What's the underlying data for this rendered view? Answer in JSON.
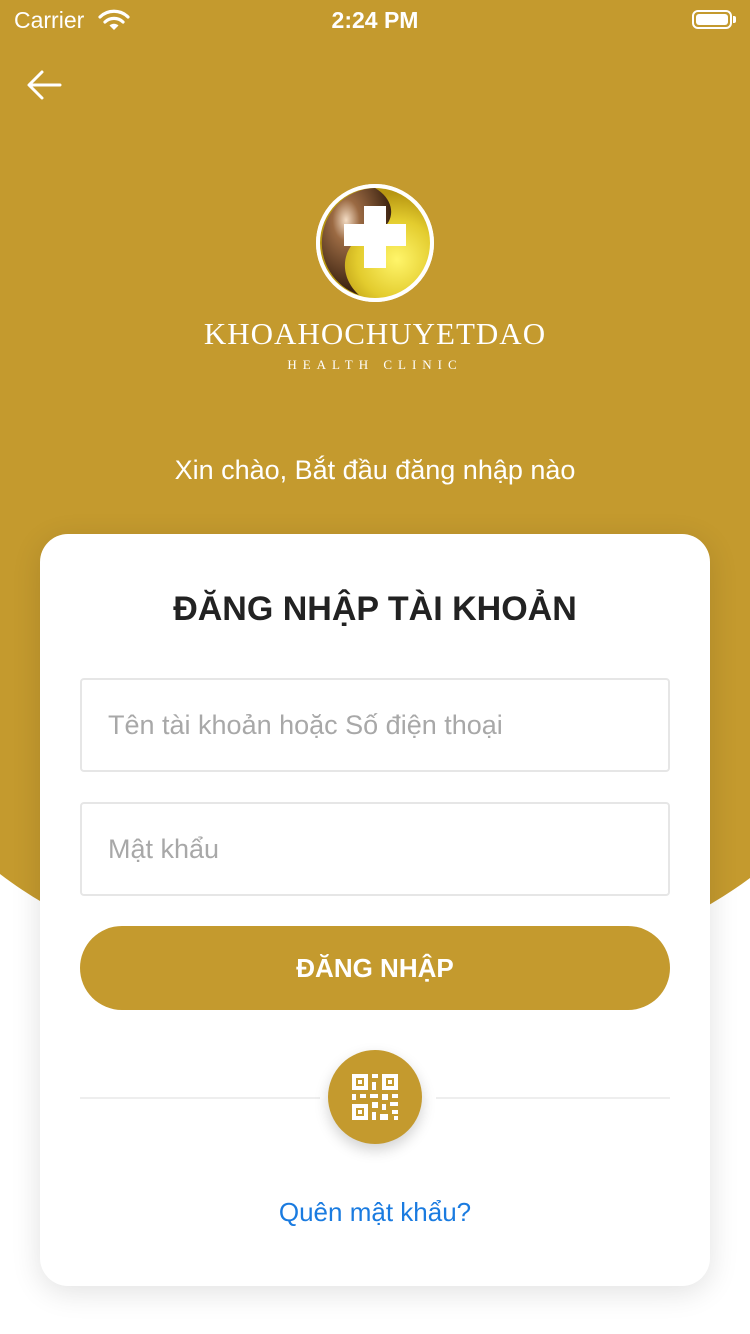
{
  "colors": {
    "brand": "#c49a2e",
    "link": "#1a7be0",
    "white": "#ffffff"
  },
  "status_bar": {
    "carrier": "Carrier",
    "time": "2:24 PM",
    "icons": [
      "wifi-icon",
      "battery-icon"
    ]
  },
  "header": {
    "back_icon": "arrow-left-icon",
    "brand_name": "KHOAHOCHUYETDAO",
    "brand_subtitle": "HEALTH CLINIC",
    "greeting": "Xin chào, Bắt đầu đăng nhập nào"
  },
  "login_card": {
    "title": "ĐĂNG NHẬP TÀI KHOẢN",
    "username": {
      "value": "",
      "placeholder": "Tên tài khoản hoặc Số điện thoại"
    },
    "password": {
      "value": "",
      "placeholder": "Mật khẩu"
    },
    "submit_label": "ĐĂNG NHẬP",
    "qr_icon": "qr-code-icon",
    "forgot_password": "Quên mật khẩu?"
  }
}
